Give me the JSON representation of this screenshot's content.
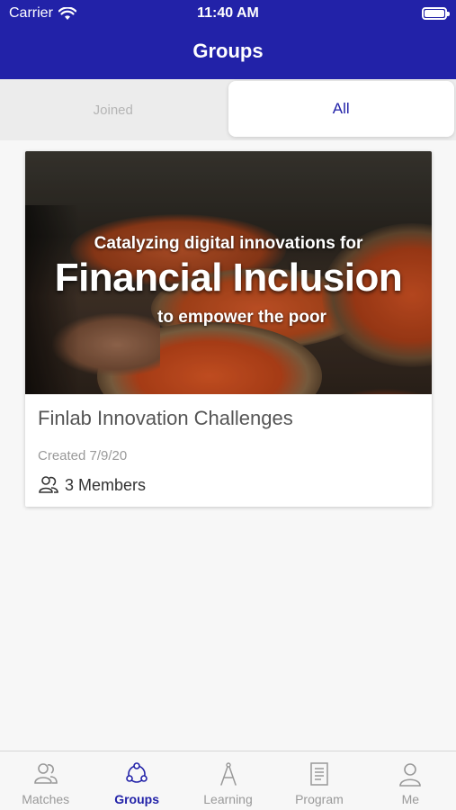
{
  "status_bar": {
    "carrier": "Carrier",
    "time": "11:40 AM"
  },
  "header": {
    "title": "Groups"
  },
  "tabs": {
    "joined": "Joined",
    "all": "All",
    "selected": "All"
  },
  "group_card": {
    "image_text": {
      "line1": "Catalyzing digital innovations for",
      "line2": "Financial Inclusion",
      "line3": "to empower the poor"
    },
    "title": "Finlab Innovation Challenges",
    "created": "Created 7/9/20",
    "members": "3 Members"
  },
  "tab_bar": {
    "items": [
      {
        "label": "Matches",
        "icon": "matches-icon",
        "active": false
      },
      {
        "label": "Groups",
        "icon": "groups-icon",
        "active": true
      },
      {
        "label": "Learning",
        "icon": "learning-icon",
        "active": false
      },
      {
        "label": "Program",
        "icon": "program-icon",
        "active": false
      },
      {
        "label": "Me",
        "icon": "person-icon",
        "active": false
      }
    ]
  },
  "colors": {
    "brand": "#2222a8",
    "background": "#f7f7f7",
    "inactive": "#999999"
  }
}
